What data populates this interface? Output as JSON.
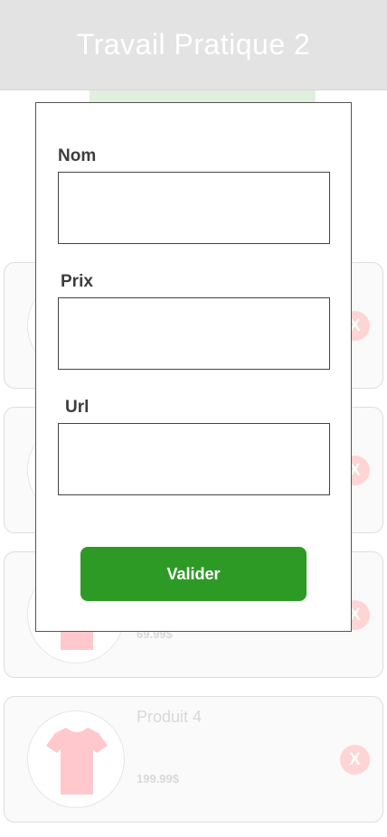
{
  "header": {
    "title": "Travail Pratique 2"
  },
  "products": [
    {
      "name": "",
      "price": ""
    },
    {
      "name": "",
      "price": ""
    },
    {
      "name": "",
      "price": "69.99$"
    },
    {
      "name": "Produit 4",
      "price": "199.99$"
    }
  ],
  "delete_label": "X",
  "modal": {
    "name_label": "Nom",
    "price_label": "Prix",
    "url_label": "Url",
    "name_value": "",
    "price_value": "",
    "url_value": "",
    "submit_label": "Valider"
  },
  "colors": {
    "header_bg": "#e3e3e3",
    "submit_bg": "#2e9a26",
    "delete_bg": "#ffd4d4",
    "shirt": "#ffc8cc"
  },
  "icons": {
    "product_image": "tshirt-icon"
  }
}
